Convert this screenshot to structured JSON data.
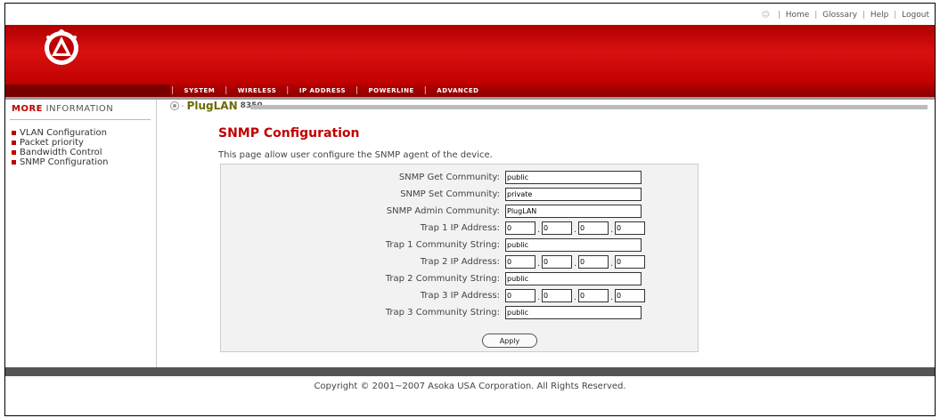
{
  "top_links": {
    "home": "Home",
    "glossary": "Glossary",
    "help": "Help",
    "logout": "Logout"
  },
  "nav": [
    {
      "label": "SYSTEM"
    },
    {
      "label": "WIRELESS"
    },
    {
      "label": "IP ADDRESS"
    },
    {
      "label": "POWERLINE"
    },
    {
      "label": "ADVANCED"
    }
  ],
  "sidebar": {
    "heading_bold": "MORE",
    "heading_rest": "INFORMATION",
    "items": [
      {
        "label": "VLAN Configuration"
      },
      {
        "label": "Packet priority"
      },
      {
        "label": "Bandwidth Control"
      },
      {
        "label": "SNMP Configuration"
      }
    ]
  },
  "breadcrumb": {
    "brand": "PlugLAN",
    "model": "8350"
  },
  "page": {
    "title": "SNMP Configuration",
    "description": "This page allow user configure the SNMP agent of the device."
  },
  "form": {
    "get_community": {
      "label": "SNMP Get Community:",
      "value": "public"
    },
    "set_community": {
      "label": "SNMP Set Community:",
      "value": "private"
    },
    "admin_community": {
      "label": "SNMP Admin Community:",
      "value": "PlugLAN"
    },
    "trap1_ip": {
      "label": "Trap 1 IP Address:",
      "octets": [
        "0",
        "0",
        "0",
        "0"
      ]
    },
    "trap1_community": {
      "label": "Trap 1 Community String:",
      "value": "public"
    },
    "trap2_ip": {
      "label": "Trap 2 IP Address:",
      "octets": [
        "0",
        "0",
        "0",
        "0"
      ]
    },
    "trap2_community": {
      "label": "Trap 2 Community String:",
      "value": "public"
    },
    "trap3_ip": {
      "label": "Trap 3 IP Address:",
      "octets": [
        "0",
        "0",
        "0",
        "0"
      ]
    },
    "trap3_community": {
      "label": "Trap 3 Community String:",
      "value": "public"
    },
    "apply_label": "Apply"
  },
  "footer": {
    "copyright": "Copyright © 2001~2007 Asoka USA Corporation. All Rights Reserved."
  },
  "colors": {
    "brand_red": "#c00000",
    "nav_dark": "#8d0000"
  }
}
